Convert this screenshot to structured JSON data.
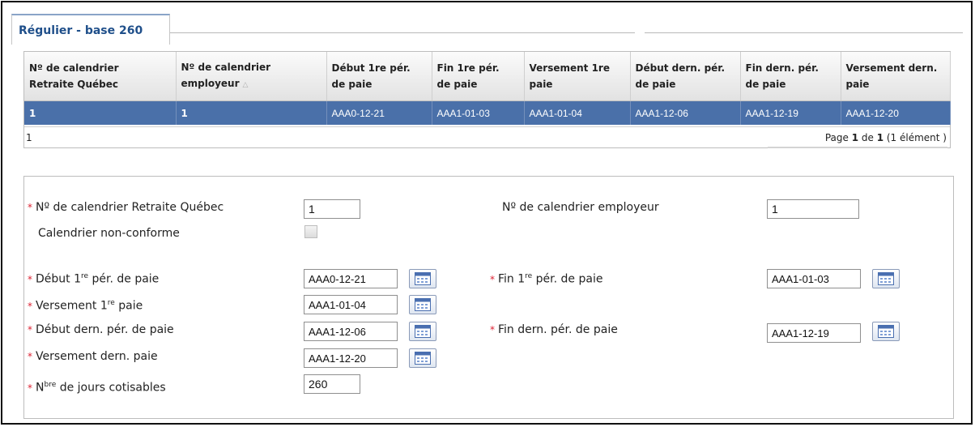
{
  "tab": {
    "label": "Régulier - base 260"
  },
  "grid": {
    "columns": [
      [
        "Nº de calendrier",
        "Retraite Québec"
      ],
      [
        "Nº de calendrier",
        "employeur"
      ],
      [
        "Début 1re pér.",
        "de paie"
      ],
      [
        "Fin 1re pér.",
        "de paie"
      ],
      [
        "Versement 1re",
        "paie"
      ],
      [
        "Début dern. pér.",
        "de paie"
      ],
      [
        "Fin dern. pér.",
        "de paie"
      ],
      [
        "Versement dern.",
        "paie"
      ]
    ],
    "rows": [
      [
        "1",
        "1",
        "AAA0-12-21",
        "AAA1-01-03",
        "AAA1-01-04",
        "AAA1-12-06",
        "AAA1-12-19",
        "AAA1-12-20"
      ]
    ],
    "pager": {
      "count": "1",
      "prefix": "Page ",
      "page": "1",
      "of": " de ",
      "total": "1",
      "items": " (1 élément )"
    }
  },
  "form": {
    "required_mark": "*",
    "calendrier_rq": {
      "label": "Nº de calendrier Retraite Québec",
      "value": "1"
    },
    "calendrier_employeur": {
      "label": "Nº de calendrier employeur",
      "value": "1"
    },
    "non_conforme": {
      "label": "Calendrier non-conforme",
      "checked": false
    },
    "debut_1re": {
      "pre": "Début 1",
      "sup": "re",
      "post": " pér. de paie",
      "value": "AAA0-12-21"
    },
    "fin_1re": {
      "pre": "Fin 1",
      "sup": "re",
      "post": " pér. de paie",
      "value": "AAA1-01-03"
    },
    "versement_1re": {
      "pre": "Versement 1",
      "sup": "re",
      "post": " paie",
      "value": "AAA1-01-04"
    },
    "debut_dern": {
      "label": "Début dern. pér. de paie",
      "value": "AAA1-12-06"
    },
    "fin_dern": {
      "label": "Fin dern. pér. de paie",
      "value": "AAA1-12-19"
    },
    "versement_dern": {
      "label": "Versement dern. paie",
      "value": "AAA1-12-20"
    },
    "jours": {
      "pre": "N",
      "sup": "bre",
      "post": " de jours cotisables",
      "value": "260"
    }
  },
  "icons": {
    "calendar": "calendar-icon",
    "sort": "sort-asc-icon"
  },
  "colors": {
    "selected_row": "#4a70a9",
    "tab_text": "#1f4f8a",
    "required": "#d23"
  }
}
